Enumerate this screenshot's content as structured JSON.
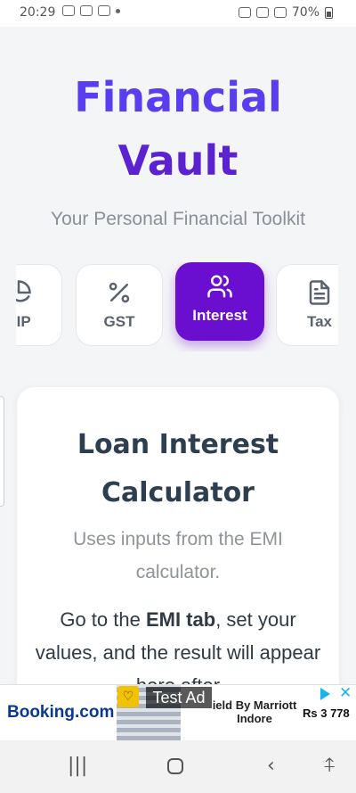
{
  "status_bar": {
    "time": "20:29",
    "battery": "70%"
  },
  "header": {
    "title_line1": "Financial",
    "title_line2": "Vault",
    "subtitle": "Your Personal Financial Toolkit"
  },
  "tabs": [
    {
      "label": "SIP",
      "icon": "pie-chart-icon",
      "active": false
    },
    {
      "label": "GST",
      "icon": "percent-icon",
      "active": false
    },
    {
      "label": "Interest",
      "icon": "users-icon",
      "active": true
    },
    {
      "label": "Tax",
      "icon": "document-icon",
      "active": false
    }
  ],
  "card": {
    "title": "Loan Interest Calculator",
    "description": "Uses inputs from the EMI calculator.",
    "instructions_prefix": "Go to the ",
    "instructions_bold": "EMI tab",
    "instructions_suffix": ", set your values, and the result will appear here after"
  },
  "ad": {
    "brand": "Booking.com",
    "label": "Test Ad",
    "text": "ield By Marriott Indore",
    "price": "Rs 3 778"
  },
  "colors": {
    "accent": "#6a0fd0",
    "title": "#5a3df0",
    "card_title": "#2c3e50"
  }
}
